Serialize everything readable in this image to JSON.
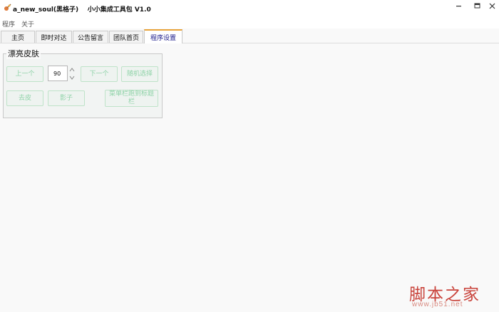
{
  "window": {
    "title": "a_new_soul(黑格子)    小小集成工具包 V1.0"
  },
  "menu": [
    "程序",
    "关于"
  ],
  "tabs": [
    {
      "label": "主页",
      "active": false
    },
    {
      "label": "即时对达",
      "active": false
    },
    {
      "label": "公告留言",
      "active": false
    },
    {
      "label": "团队首页",
      "active": false
    },
    {
      "label": "程序设置",
      "active": true
    }
  ],
  "skin_group": {
    "title": "漂亮皮肤",
    "prev_label": "上一个",
    "spin_value": "90",
    "next_label": "下一个",
    "random_label": "随机选择",
    "remove_label": "去皮",
    "shadow_label": "影子",
    "menu_to_title_label": "菜单栏跑到标题栏"
  },
  "watermark": {
    "main": "脚本之家",
    "sub": "www.jb51.net"
  },
  "colors": {
    "active_tab_accent": "#e8a33a",
    "button_text": "#8fd3a8",
    "watermark": "#c9433b"
  }
}
